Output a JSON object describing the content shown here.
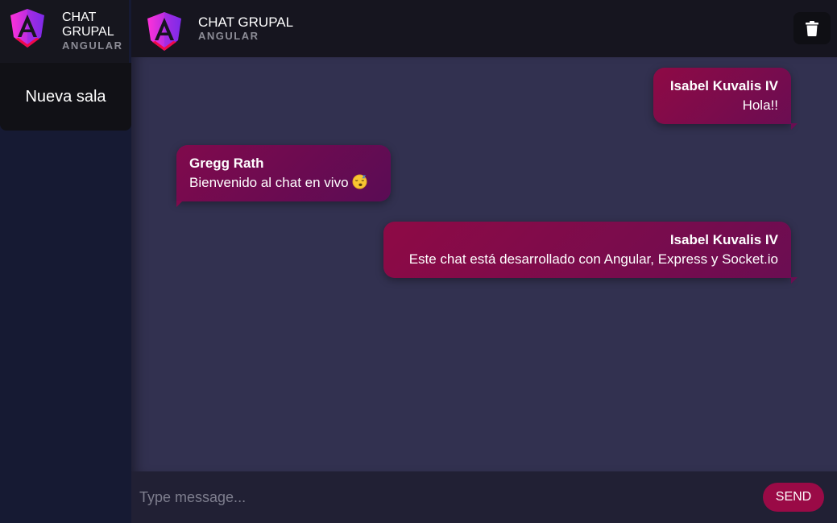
{
  "sidebar": {
    "logo_icon": "angular-logo-icon",
    "title": "CHAT GRUPAL",
    "subtitle": "ANGULAR",
    "new_room_label": "Nueva sala"
  },
  "header": {
    "logo_icon": "angular-logo-icon",
    "title": "CHAT GRUPAL",
    "subtitle": "ANGULAR",
    "delete_icon": "trash-icon"
  },
  "messages": [
    {
      "author": "Isabel Kuvalis IV",
      "text": "Hola!!",
      "side": "right"
    },
    {
      "author": "Gregg Rath",
      "text": "Bienvenido al chat en vivo",
      "emoji": "sleeping-face-emoji",
      "side": "left"
    },
    {
      "author": "Isabel Kuvalis IV",
      "text": "Este chat está desarrollado con Angular, Express y Socket.io",
      "side": "right"
    }
  ],
  "composer": {
    "placeholder": "Type message...",
    "send_label": "SEND"
  },
  "colors": {
    "accent": "#9a0a46",
    "bubble_start": "#8e0a45",
    "bubble_end": "#6b0d52",
    "chat_bg": "#323150",
    "sidebar_bg": "#161a33"
  }
}
